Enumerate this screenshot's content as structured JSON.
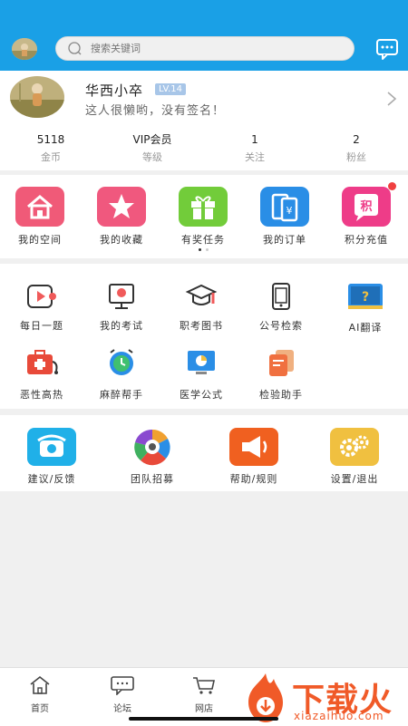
{
  "header": {
    "search_placeholder": "搜索关键词",
    "accent_color": "#1aa0e6",
    "search_icon": "search-icon",
    "message_icon": "message-icon"
  },
  "profile": {
    "name": "华西小卒",
    "level": "LV.14",
    "signature": "这人很懒哟，没有签名！",
    "stats": [
      {
        "value": "5118",
        "label": "金币"
      },
      {
        "value": "VIP会员",
        "label": "等级"
      },
      {
        "value": "1",
        "label": "关注"
      },
      {
        "value": "2",
        "label": "粉丝"
      }
    ]
  },
  "quick_menu": [
    {
      "label": "我的空间",
      "icon": "home-icon",
      "color": "#f0607a"
    },
    {
      "label": "我的收藏",
      "icon": "star-icon",
      "color": "#f06080"
    },
    {
      "label": "有奖任务",
      "icon": "gift-icon",
      "color": "#7cd040"
    },
    {
      "label": "我的订单",
      "icon": "order-icon",
      "color": "#2d8fe6"
    },
    {
      "label": "积分充值",
      "icon": "points-icon",
      "color": "#f0408a",
      "badge": true
    }
  ],
  "tools": [
    {
      "label": "每日一题",
      "icon": "play-icon"
    },
    {
      "label": "我的考试",
      "icon": "exam-icon"
    },
    {
      "label": "职考图书",
      "icon": "graduation-cap-icon"
    },
    {
      "label": "公号检索",
      "icon": "phone-icon"
    },
    {
      "label": "AI翻译",
      "icon": "translate-book-icon"
    },
    {
      "label": "恶性高热",
      "icon": "medical-kit-icon"
    },
    {
      "label": "麻醉帮手",
      "icon": "alarm-clock-icon"
    },
    {
      "label": "医学公式",
      "icon": "chart-monitor-icon"
    },
    {
      "label": "检验助手",
      "icon": "lab-cards-icon"
    }
  ],
  "more": [
    {
      "label": "建议/反馈",
      "icon": "telephone-icon"
    },
    {
      "label": "团队招募",
      "icon": "team-icon"
    },
    {
      "label": "帮助/规则",
      "icon": "megaphone-icon"
    },
    {
      "label": "设置/退出",
      "icon": "gears-icon"
    }
  ],
  "tabbar": [
    {
      "label": "首页",
      "icon": "home-outline-icon"
    },
    {
      "label": "论坛",
      "icon": "chat-icon"
    },
    {
      "label": "网店",
      "icon": "cart-icon"
    }
  ],
  "watermark": {
    "text": "下载火",
    "sub": "xiazaihuo.com"
  }
}
